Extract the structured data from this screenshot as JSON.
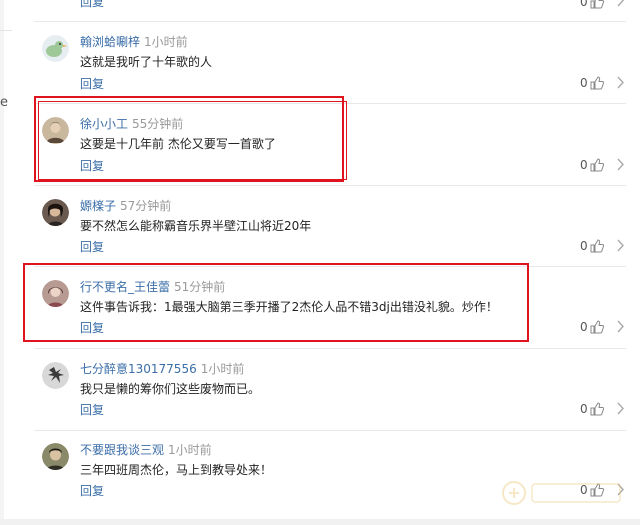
{
  "left_edge_char": "e",
  "comments": [
    {
      "username": "",
      "time": "",
      "text": "",
      "reply": "回复",
      "likes": "0"
    },
    {
      "username": "翰浏蛤唰梓",
      "time": "1小时前",
      "text": "这就是我听了十年歌的人",
      "reply": "回复",
      "likes": "0",
      "avatar_color": "#b9d8b0"
    },
    {
      "username": "徐小小工",
      "time": "55分钟前",
      "text": "这要是十几年前 杰伦又要写一首歌了",
      "reply": "回复",
      "likes": "0",
      "avatar_color": "#6b5a4a"
    },
    {
      "username": "嫄檪子",
      "time": "57分钟前",
      "text": "要不然怎么能称霸音乐界半壁江山将近20年",
      "reply": "回复",
      "likes": "0",
      "avatar_color": "#3a2f2a"
    },
    {
      "username": "行不更名_王佳蕾",
      "time": "51分钟前",
      "text": "这件事告诉我：1最强大脑第三季开播了2杰伦人品不错3dj出错没礼貌。炒作！",
      "reply": "回复",
      "likes": "0",
      "avatar_color": "#7a5a55"
    },
    {
      "username": "七分醉意130177556",
      "time": "1小时前",
      "text": "我只是懒的筹你们这些废物而已。",
      "reply": "回复",
      "likes": "0",
      "avatar_color": "#555555"
    },
    {
      "username": "不要跟我谈三观",
      "time": "1小时前",
      "text": "三年四班周杰伦，马上到教导处来！",
      "reply": "回复",
      "likes": "0",
      "avatar_color": "#4a4a3a"
    }
  ],
  "colors": {
    "link": "#3b6ea8",
    "highlight": "#e0141e",
    "time": "#999999"
  },
  "icons": {
    "like": "thumbs-up-icon",
    "more": "chevron-right-icon"
  }
}
